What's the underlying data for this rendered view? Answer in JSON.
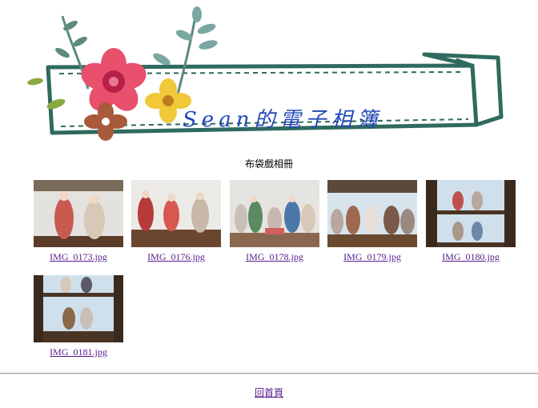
{
  "banner": {
    "title": "Sean的電子相簿",
    "colors": {
      "ribbon": "#2f6a5e",
      "title_text": "#2446b8",
      "flower_pink": "#e8506e",
      "flower_yellow": "#f0c838",
      "flower_brown": "#a85a3a",
      "leaf": "#5c8a7e"
    }
  },
  "album": {
    "title": "布袋戲相冊"
  },
  "photos": [
    {
      "filename": "IMG_0173.jpg"
    },
    {
      "filename": "IMG_0176.jpg"
    },
    {
      "filename": "IMG_0178.jpg"
    },
    {
      "filename": "IMG_0179.jpg"
    },
    {
      "filename": "IMG_0180.jpg"
    },
    {
      "filename": "IMG_0181.jpg"
    }
  ],
  "footer": {
    "home_link": "回首頁"
  }
}
